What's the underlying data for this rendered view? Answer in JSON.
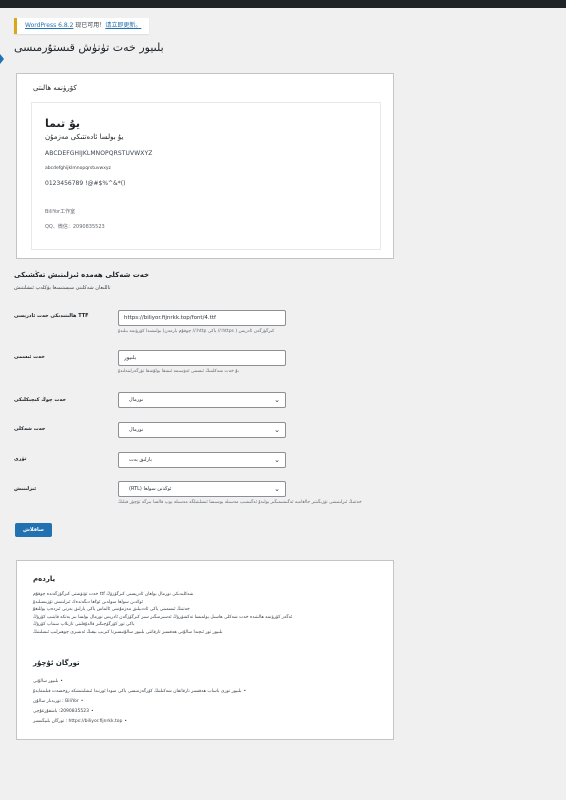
{
  "notice": {
    "version_link": "WordPress 6.8.2",
    "text": " 现已可用！",
    "update_link": "请立即更新。"
  },
  "page": {
    "title": "بلىيور خەت تۈنۈش قىستۇرمىسى"
  },
  "preview": {
    "title": "كۆرۈنمە ھالىتى",
    "heading": "يۇ تىما",
    "subheading": "يۇ بولسا ئادەتتىكى مەزمۇن",
    "uppercase": "ABCDEFGHIJKLMNOPQRSTUVWXYZ",
    "lowercase": "abcdefghijklmnopqrstuvwxyz",
    "numbers": "0123456789 !@#$%^&*()",
    "brand": "BiliYor工作室",
    "contact": "QQ、微信：2090835523"
  },
  "settings": {
    "heading": "خەت شەكلى ھەمدە ئىزلىنىش تەڭشىكى",
    "description": "تاللىغان شەكلىنى سېستىمىغا يۈكلەپ ئىشلىتىش"
  },
  "fields": {
    "ttf": {
      "label": "TTF ھالىتىدىكى خەت ئادرېسى",
      "value": "https://biliyor.fijnrkk.top/font/4.ttf",
      "help": "كىرگۈزگەن ئادرېس ( https:// ياكى http:// چوقۇم بارمەن)  بولىشىدا كۆرۈنمە بىلىدۇ"
    },
    "name": {
      "label": "خەت ئىسمى",
      "value": "بلىيور",
      "help": "بۇ خەت شەكلىنىڭ ئىسمى ئەۋسىمە ئىشقا بولۇشقا تۈرگەرلىنەلىدۇ"
    },
    "weight": {
      "label": "خەت چوڭ كىچىكلىكى",
      "value": "نورمال"
    },
    "style": {
      "label": "خەت شەكلى",
      "value": "نورمال"
    },
    "type": {
      "label": "تۈرى",
      "value": "بارلىق بەت"
    },
    "direction": {
      "label": "ئىزلىنىش",
      "value": "ئوڭدىن سولغا  (RTL)",
      "help": "خەتنىڭ ئىزلىنىشى تۈزىگىتىر جالغامبە ئەگىشىمىگىر بولىدۇ ئەگىشىپ مەسىلە يوسىسا ئىشلىتىلگە مەسىلە يوپ قالسا بىزگە تۈچۈر قىلىڭ"
    }
  },
  "save_button": "ساقلاش",
  "help": {
    "title": "ياردەم",
    "items": [
      "شەكلىدىكى نورمال بولغان ئادرېسنى كىرگۈزۈڭ ttf خەت تۈنۈشتى كىرگۈزگەندە چوقۇم",
      "ئوڭدىن سولغا سولدىن ئوڭغا دىگەندەك ئىزلىنىش تۈزىسىلىدۇ",
      "خەتنىڭ ئىسمىنى ياكى ئاددىيلىق مەزمۇنىنى ئالماش ياكى يارلىق بەرنى ئىزدەپ يوللىغۇ",
      "ئەگەر كۆرۈنمە ھالىتىدە خەت شەكلى ھاسىل بولمىسا تەكشۈرۈڭ ئەسىرمىگىز سىز كىرگۈزگەن ئادرېس نورمال بولسا بىر بەتكە قايتىپ كۆرۈڭ",
      "ياكى تور كۈرگۈچىڭىز قالدۇقلىنى تازىلاپ سىناپ كۆرۈڭ",
      "بلىيور تور ئىچىدا سالۇنى ھەقسىز تارقاتتى بلىيور سالۇنىسىزنا كىرىپ بېقىڭ ئەشىرى چوھىرلىپ ئىشلىتىڭ"
    ]
  },
  "contact": {
    "title": "تورگان ئۇچۇر",
    "items": [
      "بلىيور سالۇنى",
      "بلىيور تورى باساب ھەقسىز تارقاتقان شەكىلنىڭ كۆرگەزمىسى ياكى سودا ئورنىدا ئىشلىتىشكە روخسەت قىلىنمايدۇ",
      "BiliYor : تورىدىار سالۇن",
      "2090835523: باشقۇرغۇچى",
      "https://biliyor.fijnrkk.top : تورگان بلىيگىسىر"
    ]
  }
}
